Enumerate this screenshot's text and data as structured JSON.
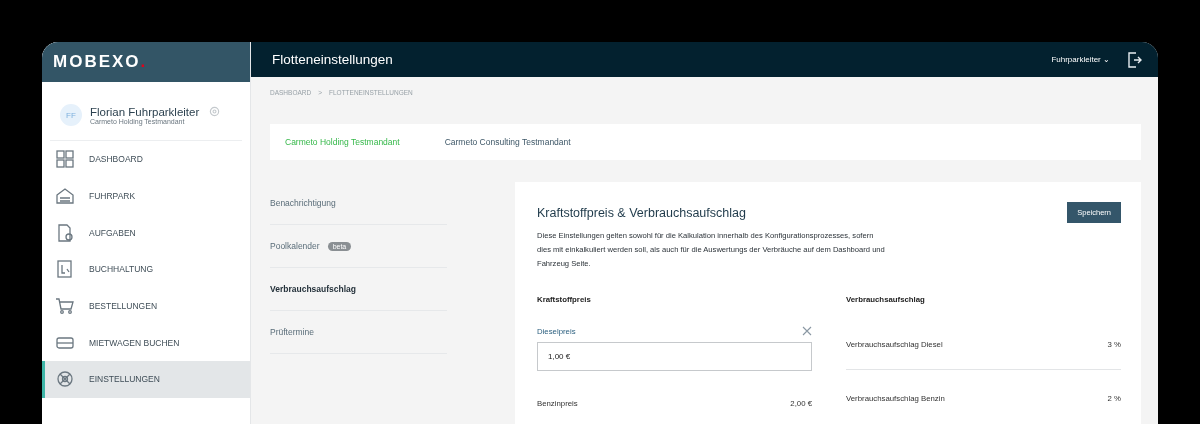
{
  "brand": {
    "name": "MOBEXO",
    "dot": "."
  },
  "header": {
    "title": "Flotteneinstellungen",
    "user_menu": "Fuhrparkleiter",
    "user_caret": "⌄"
  },
  "profile": {
    "initials": "FF",
    "name": "Florian Fuhrparkleiter",
    "company": "Carmeto Holding Testmandant"
  },
  "sidebar": {
    "items": [
      {
        "label": "DASHBOARD",
        "kind": "dashboard",
        "selected": false
      },
      {
        "label": "FUHRPARK",
        "kind": "garage",
        "selected": false
      },
      {
        "label": "AUFGABEN",
        "kind": "tasks",
        "selected": false
      },
      {
        "label": "BUCHHALTUNG",
        "kind": "ledger",
        "selected": false
      },
      {
        "label": "BESTELLUNGEN",
        "kind": "cart",
        "selected": false
      },
      {
        "label": "MIETWAGEN BUCHEN",
        "kind": "car",
        "selected": false
      },
      {
        "label": "EINSTELLUNGEN",
        "kind": "gear",
        "selected": true
      }
    ]
  },
  "breadcrumb": [
    {
      "label": "DASHBOARD"
    },
    {
      "label": "FLOTTENEINSTELLUNGEN"
    }
  ],
  "breadcrumb_separator": ">",
  "tabs": [
    {
      "label": "Carmeto Holding Testmandant",
      "selected": true
    },
    {
      "label": "Carmeto Consulting Testmandant",
      "selected": false
    }
  ],
  "settings_menu": [
    {
      "label": "Benachrichtigung",
      "selected": false
    },
    {
      "label": "Poolkalender",
      "badge": "beta",
      "selected": false
    },
    {
      "label": "Verbrauchsaufschlag",
      "selected": true
    },
    {
      "label": "Prüftermine",
      "selected": false
    }
  ],
  "card": {
    "title": "Kraftstoffpreis & Verbrauchsaufschlag",
    "save_button": "Speichern",
    "description": "Diese Einstellungen gelten sowohl für die Kalkulation innerhalb des Konfigurationsprozesses, sofern dies mit einkalkuliert werden soll, als auch für die Auswertungs der Verbräuche auf dem Dashboard und Fahrzeug Seite.",
    "fuel_price": {
      "heading": "Kraftstoffpreis",
      "field": {
        "label": "Dieselpreis",
        "value": "1,00 €"
      },
      "rows": [
        {
          "label": "Benzinpreis",
          "value": "2,00 €"
        }
      ]
    },
    "surcharge": {
      "heading": "Verbrauchsaufschlag",
      "rows": [
        {
          "label": "Verbrauchsaufschlag Diesel",
          "value": "3 %"
        },
        {
          "label": "Verbrauchsaufschlag Benzin",
          "value": "2 %"
        }
      ]
    }
  }
}
